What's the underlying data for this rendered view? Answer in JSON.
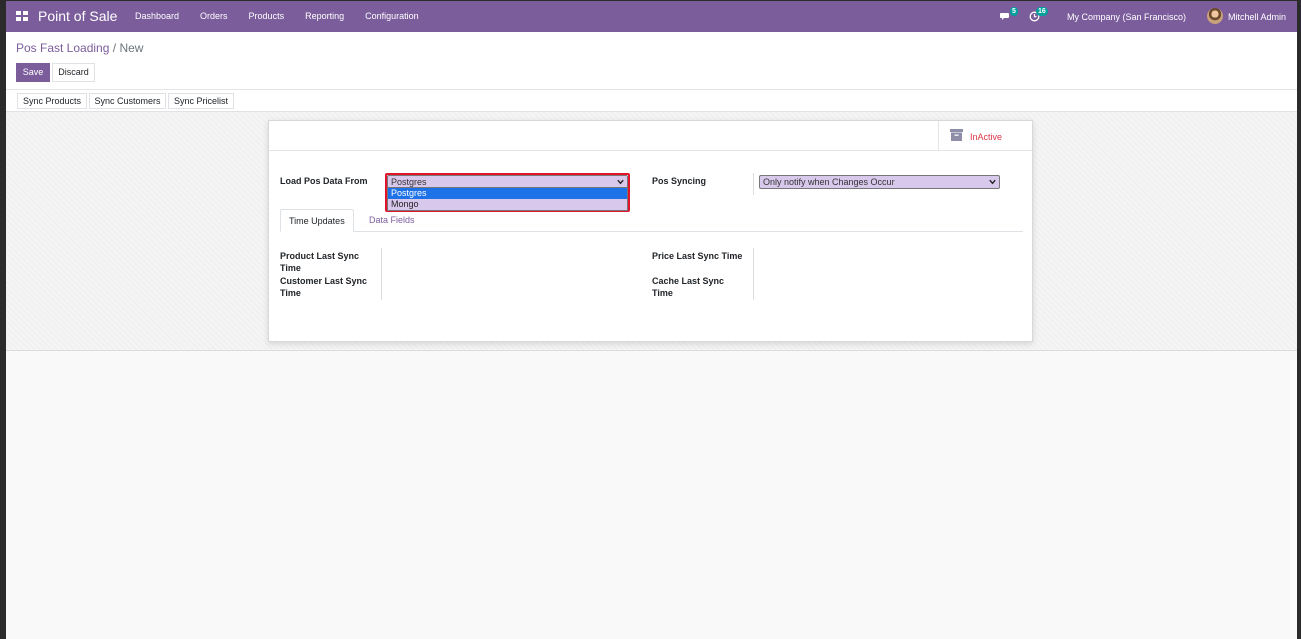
{
  "navbar": {
    "app_title": "Point of Sale",
    "menu": [
      "Dashboard",
      "Orders",
      "Products",
      "Reporting",
      "Configuration"
    ],
    "chat_count": "5",
    "activity_count": "16",
    "company": "My Company (San Francisco)",
    "user": "Mitchell Admin",
    "accent_color": "#7c5d9c"
  },
  "breadcrumb": {
    "parent": "Pos Fast Loading",
    "separator": "/",
    "current": "New"
  },
  "actions": {
    "save": "Save",
    "discard": "Discard"
  },
  "sync_buttons": [
    "Sync Products",
    "Sync Customers",
    "Sync Pricelist"
  ],
  "form": {
    "status_label": "InActive",
    "load_from": {
      "label": "Load Pos Data From",
      "value": "Postgres",
      "options": [
        "Postgres",
        "Mongo"
      ]
    },
    "syncing": {
      "label": "Pos Syncing",
      "value": "Only notify when Changes Occur"
    },
    "tabs": [
      "Time Updates",
      "Data Fields"
    ],
    "fields": {
      "product_last_sync": "Product Last Sync Time",
      "customer_last_sync": "Customer Last Sync Time",
      "price_last_sync": "Price Last Sync Time",
      "cache_last_sync": "Cache Last Sync Time"
    }
  }
}
